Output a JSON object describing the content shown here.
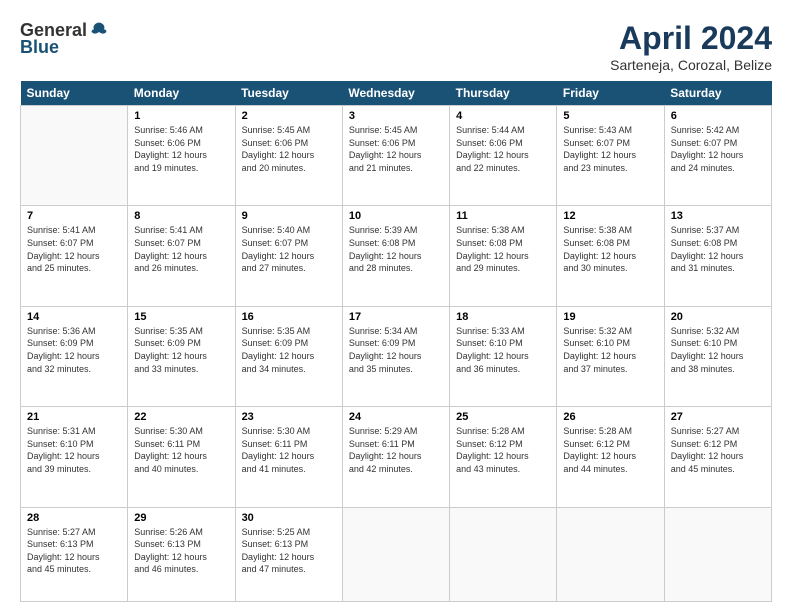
{
  "header": {
    "logo_general": "General",
    "logo_blue": "Blue",
    "title": "April 2024",
    "subtitle": "Sarteneja, Corozal, Belize"
  },
  "columns": [
    "Sunday",
    "Monday",
    "Tuesday",
    "Wednesday",
    "Thursday",
    "Friday",
    "Saturday"
  ],
  "weeks": [
    [
      {
        "num": "",
        "info": ""
      },
      {
        "num": "1",
        "info": "Sunrise: 5:46 AM\nSunset: 6:06 PM\nDaylight: 12 hours\nand 19 minutes."
      },
      {
        "num": "2",
        "info": "Sunrise: 5:45 AM\nSunset: 6:06 PM\nDaylight: 12 hours\nand 20 minutes."
      },
      {
        "num": "3",
        "info": "Sunrise: 5:45 AM\nSunset: 6:06 PM\nDaylight: 12 hours\nand 21 minutes."
      },
      {
        "num": "4",
        "info": "Sunrise: 5:44 AM\nSunset: 6:06 PM\nDaylight: 12 hours\nand 22 minutes."
      },
      {
        "num": "5",
        "info": "Sunrise: 5:43 AM\nSunset: 6:07 PM\nDaylight: 12 hours\nand 23 minutes."
      },
      {
        "num": "6",
        "info": "Sunrise: 5:42 AM\nSunset: 6:07 PM\nDaylight: 12 hours\nand 24 minutes."
      }
    ],
    [
      {
        "num": "7",
        "info": "Sunrise: 5:41 AM\nSunset: 6:07 PM\nDaylight: 12 hours\nand 25 minutes."
      },
      {
        "num": "8",
        "info": "Sunrise: 5:41 AM\nSunset: 6:07 PM\nDaylight: 12 hours\nand 26 minutes."
      },
      {
        "num": "9",
        "info": "Sunrise: 5:40 AM\nSunset: 6:07 PM\nDaylight: 12 hours\nand 27 minutes."
      },
      {
        "num": "10",
        "info": "Sunrise: 5:39 AM\nSunset: 6:08 PM\nDaylight: 12 hours\nand 28 minutes."
      },
      {
        "num": "11",
        "info": "Sunrise: 5:38 AM\nSunset: 6:08 PM\nDaylight: 12 hours\nand 29 minutes."
      },
      {
        "num": "12",
        "info": "Sunrise: 5:38 AM\nSunset: 6:08 PM\nDaylight: 12 hours\nand 30 minutes."
      },
      {
        "num": "13",
        "info": "Sunrise: 5:37 AM\nSunset: 6:08 PM\nDaylight: 12 hours\nand 31 minutes."
      }
    ],
    [
      {
        "num": "14",
        "info": "Sunrise: 5:36 AM\nSunset: 6:09 PM\nDaylight: 12 hours\nand 32 minutes."
      },
      {
        "num": "15",
        "info": "Sunrise: 5:35 AM\nSunset: 6:09 PM\nDaylight: 12 hours\nand 33 minutes."
      },
      {
        "num": "16",
        "info": "Sunrise: 5:35 AM\nSunset: 6:09 PM\nDaylight: 12 hours\nand 34 minutes."
      },
      {
        "num": "17",
        "info": "Sunrise: 5:34 AM\nSunset: 6:09 PM\nDaylight: 12 hours\nand 35 minutes."
      },
      {
        "num": "18",
        "info": "Sunrise: 5:33 AM\nSunset: 6:10 PM\nDaylight: 12 hours\nand 36 minutes."
      },
      {
        "num": "19",
        "info": "Sunrise: 5:32 AM\nSunset: 6:10 PM\nDaylight: 12 hours\nand 37 minutes."
      },
      {
        "num": "20",
        "info": "Sunrise: 5:32 AM\nSunset: 6:10 PM\nDaylight: 12 hours\nand 38 minutes."
      }
    ],
    [
      {
        "num": "21",
        "info": "Sunrise: 5:31 AM\nSunset: 6:10 PM\nDaylight: 12 hours\nand 39 minutes."
      },
      {
        "num": "22",
        "info": "Sunrise: 5:30 AM\nSunset: 6:11 PM\nDaylight: 12 hours\nand 40 minutes."
      },
      {
        "num": "23",
        "info": "Sunrise: 5:30 AM\nSunset: 6:11 PM\nDaylight: 12 hours\nand 41 minutes."
      },
      {
        "num": "24",
        "info": "Sunrise: 5:29 AM\nSunset: 6:11 PM\nDaylight: 12 hours\nand 42 minutes."
      },
      {
        "num": "25",
        "info": "Sunrise: 5:28 AM\nSunset: 6:12 PM\nDaylight: 12 hours\nand 43 minutes."
      },
      {
        "num": "26",
        "info": "Sunrise: 5:28 AM\nSunset: 6:12 PM\nDaylight: 12 hours\nand 44 minutes."
      },
      {
        "num": "27",
        "info": "Sunrise: 5:27 AM\nSunset: 6:12 PM\nDaylight: 12 hours\nand 45 minutes."
      }
    ],
    [
      {
        "num": "28",
        "info": "Sunrise: 5:27 AM\nSunset: 6:13 PM\nDaylight: 12 hours\nand 45 minutes."
      },
      {
        "num": "29",
        "info": "Sunrise: 5:26 AM\nSunset: 6:13 PM\nDaylight: 12 hours\nand 46 minutes."
      },
      {
        "num": "30",
        "info": "Sunrise: 5:25 AM\nSunset: 6:13 PM\nDaylight: 12 hours\nand 47 minutes."
      },
      {
        "num": "",
        "info": ""
      },
      {
        "num": "",
        "info": ""
      },
      {
        "num": "",
        "info": ""
      },
      {
        "num": "",
        "info": ""
      }
    ]
  ]
}
